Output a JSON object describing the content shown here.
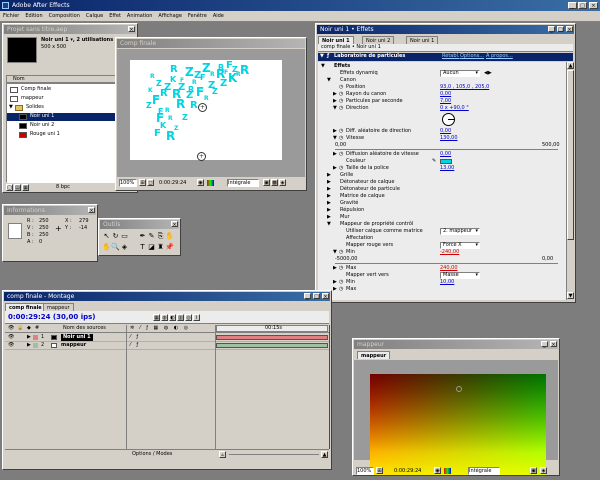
{
  "app": {
    "title": "Adobe After Effects",
    "menu": [
      "Fichier",
      "Edition",
      "Composition",
      "Calque",
      "Effet",
      "Animation",
      "Affichage",
      "Fenêtre",
      "Aide"
    ]
  },
  "project": {
    "title": "Projet sans titre.aep",
    "item_name": "Noir uni 1 ▾, 2 utilisations",
    "item_size": "500 x 500",
    "col_name": "Nom",
    "items": [
      {
        "label": "Comp finale",
        "color": "#ffffff",
        "type": "comp"
      },
      {
        "label": "mappeur",
        "color": "#ffffff",
        "type": "comp"
      },
      {
        "label": "Solides",
        "color": "#e6c36a",
        "type": "folder"
      },
      {
        "label": "Noir uni 1",
        "color": "#000000",
        "type": "solid",
        "selected": true
      },
      {
        "label": "Noir uni 2",
        "color": "#000000",
        "type": "solid"
      },
      {
        "label": "Rouge uni 1",
        "color": "#cc0000",
        "type": "solid"
      }
    ],
    "footer_bpc": "8 bpc"
  },
  "comp_finale_viewer": {
    "title": "Comp finale",
    "zoom": "100%",
    "timecode": "0:00:29:24",
    "quality": "Intégrale"
  },
  "effects": {
    "title": "Noir uni 1 • Effets",
    "tabs": [
      "Noir uni 1",
      "Noir uni 2",
      "Noir uni 1"
    ],
    "crumb": "comp finale • Noir uni 1",
    "effect_name": "Laboratoire de particules",
    "effect_links": [
      "Rétabl.",
      "Options...",
      "À propos..."
    ],
    "rows": [
      {
        "indent": 0,
        "tri": "▼",
        "label": "Effets",
        "cls": "header"
      },
      {
        "indent": 1,
        "tri": "",
        "label": "Effets dynamiq",
        "value": "Aucun",
        "kind": "dropdown"
      },
      {
        "indent": 1,
        "tri": "▼",
        "label": "Canon"
      },
      {
        "indent": 2,
        "tri": "",
        "label": "Position",
        "value": "93,0  , 105,0 , 205,0",
        "kind": "value"
      },
      {
        "indent": 2,
        "tri": "▶",
        "label": "Rayon du canon",
        "value": "0,00",
        "kind": "value"
      },
      {
        "indent": 2,
        "tri": "▶",
        "label": "Particules par seconde",
        "value": "7,00",
        "kind": "value"
      },
      {
        "indent": 2,
        "tri": "▼",
        "label": "Direction",
        "value": "0 x +90,0 °",
        "kind": "value"
      },
      {
        "indent": 2,
        "tri": "",
        "label": "",
        "kind": "dial"
      },
      {
        "indent": 2,
        "tri": "▶",
        "label": "Diff. aléatoire de direction",
        "value": "0,00",
        "kind": "value"
      },
      {
        "indent": 2,
        "tri": "▼",
        "label": "Vitesse",
        "value": "130,00",
        "kind": "value"
      },
      {
        "indent": 2,
        "tri": "",
        "label": "",
        "kind": "slider",
        "min": "0,00",
        "max": "500,00"
      },
      {
        "indent": 2,
        "tri": "▶",
        "label": "Diffusion aléatoire de vitesse",
        "value": "0,00",
        "kind": "value"
      },
      {
        "indent": 2,
        "tri": "",
        "label": "Couleur",
        "kind": "swatch"
      },
      {
        "indent": 2,
        "tri": "▶",
        "label": "Taille de la police",
        "value": "13,00",
        "kind": "value"
      },
      {
        "indent": 1,
        "tri": "▶",
        "label": "Grille"
      },
      {
        "indent": 1,
        "tri": "▶",
        "label": "Détonateur de calque"
      },
      {
        "indent": 1,
        "tri": "▶",
        "label": "Détonateur de particule"
      },
      {
        "indent": 1,
        "tri": "▶",
        "label": "Matrice de calque"
      },
      {
        "indent": 1,
        "tri": "▶",
        "label": "Gravité"
      },
      {
        "indent": 1,
        "tri": "▶",
        "label": "Répulsion"
      },
      {
        "indent": 1,
        "tri": "▶",
        "label": "Mur"
      },
      {
        "indent": 1,
        "tri": "▼",
        "label": "Mappeur de propriété contrôl"
      },
      {
        "indent": 2,
        "tri": "",
        "label": "Utiliser calque comme matrice",
        "value": "2. mappeur",
        "kind": "dropdown"
      },
      {
        "indent": 2,
        "tri": "",
        "label": "Affectation"
      },
      {
        "indent": 2,
        "tri": "",
        "label": "Mapper rouge vers",
        "value": "Force X",
        "kind": "dropdown"
      },
      {
        "indent": 2,
        "tri": "▼",
        "label": "Min",
        "value": "-240,00",
        "kind": "value_red"
      },
      {
        "indent": 2,
        "tri": "",
        "label": "",
        "kind": "slider",
        "min": "-5000,00",
        "max": "0,00"
      },
      {
        "indent": 2,
        "tri": "▶",
        "label": "Max",
        "value": "240,00",
        "kind": "value_red"
      },
      {
        "indent": 2,
        "tri": "",
        "label": "Mapper vert vers",
        "value": "Masse",
        "kind": "dropdown"
      },
      {
        "indent": 2,
        "tri": "▶",
        "label": "Min",
        "value": "10,00",
        "kind": "value"
      },
      {
        "indent": 2,
        "tri": "▶",
        "label": "Max",
        "value": "",
        "kind": "value"
      }
    ]
  },
  "info": {
    "title": "Informations",
    "r": "250",
    "g": "250",
    "b": "250",
    "a": "0",
    "x": "279",
    "y": "-14",
    "labels": {
      "r": "R :",
      "g": "V :",
      "b": "B :",
      "a": "A :",
      "x": "X :",
      "y": "Y :"
    }
  },
  "tools": {
    "title": "Outils"
  },
  "timeline": {
    "title": "comp finale - Montage",
    "tabs": [
      "comp finale",
      "mappeur"
    ],
    "timecode": "0:00:29:24 (30,00 ips)",
    "col_source": "Nom des sources",
    "marker": "00:15s",
    "switches_label": "Options / Modes",
    "layers": [
      {
        "num": "1",
        "name": "Noir uni 1",
        "selected": true,
        "bar": "#e08080"
      },
      {
        "num": "2",
        "name": "mappeur",
        "selected": false,
        "bar": "#a0c0a0"
      }
    ]
  },
  "mappeur_viewer": {
    "title": "mappeur",
    "tab": "mappeur",
    "zoom": "100%",
    "timecode": "0:00:29:24",
    "quality": "Intégrale"
  },
  "colors": {
    "title_active": "#0a246a",
    "panel": "#d4d0c8",
    "desktop": "#7d7d7d",
    "particles": "#00d4e0"
  },
  "chart_data": null
}
